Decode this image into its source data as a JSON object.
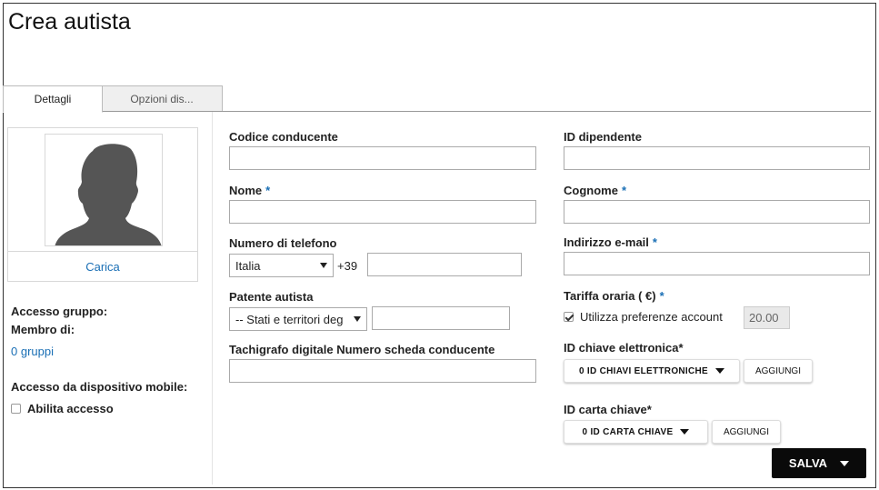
{
  "page": {
    "title": "Crea autista"
  },
  "tabs": [
    {
      "label": "Dettagli"
    },
    {
      "label": "Opzioni dis..."
    }
  ],
  "sidebar": {
    "upload_label": "Carica",
    "group_access_label": "Accesso gruppo:",
    "member_of_label": "Membro di:",
    "groups_link": "0 gruppi",
    "mobile_access_label": "Accesso da dispositivo mobile:",
    "enable_access_label": "Abilita accesso",
    "enable_access_checked": false
  },
  "form": {
    "driver_code": {
      "label": "Codice conducente",
      "value": ""
    },
    "employee_id": {
      "label": "ID dipendente",
      "value": ""
    },
    "first_name": {
      "label": "Nome",
      "required_mark": "*",
      "value": ""
    },
    "last_name": {
      "label": "Cognome",
      "required_mark": "*",
      "value": ""
    },
    "phone": {
      "label": "Numero di telefono",
      "country": "Italia",
      "prefix": "+39",
      "value": ""
    },
    "email": {
      "label": "Indirizzo e-mail",
      "required_mark": "*",
      "value": ""
    },
    "license": {
      "label": "Patente autista",
      "region_select": "-- Stati e territori deg",
      "value": ""
    },
    "hourly_rate": {
      "label": "Tariffa oraria ( €)",
      "required_mark": "*",
      "use_account_pref_label": "Utilizza preferenze account",
      "use_account_pref_checked": true,
      "value": "20.00"
    },
    "tachograph": {
      "label": "Tachigrafo digitale Numero scheda conducente",
      "value": ""
    },
    "electronic_key": {
      "label": "ID chiave elettronica*",
      "dropdown_label": "0 ID CHIAVI ELETTRONICHE",
      "add_label": "AGGIUNGI"
    },
    "key_card": {
      "label": "ID carta chiave*",
      "dropdown_label": "0 ID CARTA CHIAVE",
      "add_label": "AGGIUNGI"
    }
  },
  "actions": {
    "save_label": "SALVA"
  },
  "colors": {
    "link": "#1a6fb5",
    "save_bg": "#0a0a0a"
  }
}
